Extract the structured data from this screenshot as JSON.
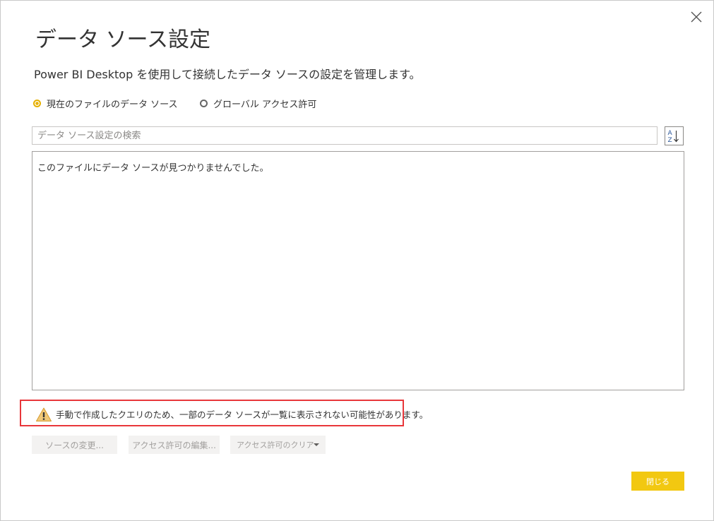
{
  "dialog": {
    "title": "データ ソース設定",
    "subtitle": "Power BI Desktop を使用して接続したデータ ソースの設定を管理します。",
    "close_icon": "close-icon"
  },
  "scope": {
    "options": [
      {
        "label": "現在のファイルのデータ ソース",
        "selected": true
      },
      {
        "label": "グローバル アクセス許可",
        "selected": false
      }
    ]
  },
  "search": {
    "placeholder": "データ ソース設定の検索",
    "value": ""
  },
  "sort_button": {
    "icon": "sort-az-icon"
  },
  "list": {
    "empty_message": "このファイルにデータ ソースが見つかりませんでした。"
  },
  "warning": {
    "icon": "warning-icon",
    "message": "手動で作成したクエリのため、一部のデータ ソースが一覧に表示されない可能性があります。",
    "highlight_color": "#e8363a"
  },
  "buttons": {
    "change_source": "ソースの変更...",
    "edit_permissions": "アクセス許可の編集...",
    "clear_permissions": "アクセス許可のクリア",
    "close": "閉じる"
  },
  "colors": {
    "accent": "#f2c811",
    "radio_selected": "#e6b000"
  }
}
